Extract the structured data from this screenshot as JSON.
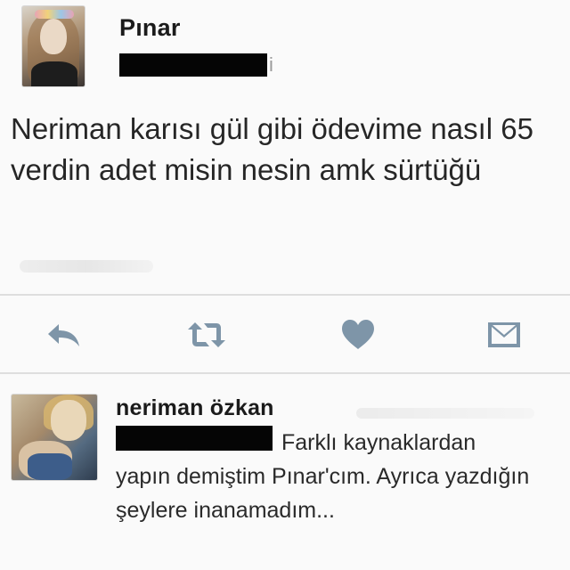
{
  "tweet": {
    "author": "Pınar",
    "handle_tail": "i",
    "text": "Neriman karısı gül gibi ödevime nasıl 65 verdin adet misin nesin amk sürtüğü"
  },
  "actions": {
    "reply_icon": "reply-icon",
    "retweet_icon": "retweet-icon",
    "like_icon": "heart-icon",
    "dm_icon": "envelope-icon",
    "icon_color": "#7e95a8"
  },
  "reply": {
    "author": "neriman özkan",
    "text": "Farklı kaynaklardan yapın demiştim Pınar'cım. Ayrıca yazdığın şeylere inanamadım..."
  }
}
